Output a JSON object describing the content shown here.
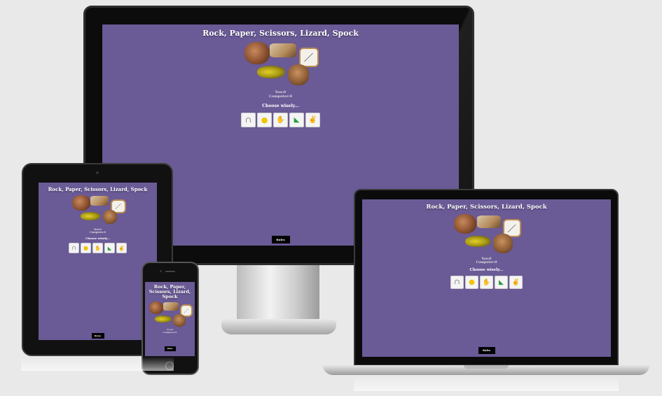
{
  "game": {
    "title": "Rock, Paper, Scissors, Lizard, Spock",
    "title_mobile_lines": [
      "Rock, Paper,",
      "Scissors, Lizard,",
      "Spock"
    ],
    "you_label": "You:0",
    "computer_label": "Computer:0",
    "prompt": "Choose wisely...",
    "rules_label": "Rules",
    "choices": [
      {
        "name": "spock",
        "glyph": "∩",
        "color": "#777777"
      },
      {
        "name": "rock",
        "glyph": "●",
        "color": "#f0c400"
      },
      {
        "name": "paper",
        "glyph": "✋",
        "color": "#e23a3a"
      },
      {
        "name": "lizard",
        "glyph": "◣",
        "color": "#2a9a3a"
      },
      {
        "name": "scissors",
        "glyph": "✌",
        "color": "#333333"
      }
    ]
  },
  "colors": {
    "background": "#6a5a96",
    "page": "#e9e9e9",
    "rules_button": "#000000"
  },
  "devices": [
    "desktop",
    "tablet",
    "laptop",
    "phone"
  ]
}
